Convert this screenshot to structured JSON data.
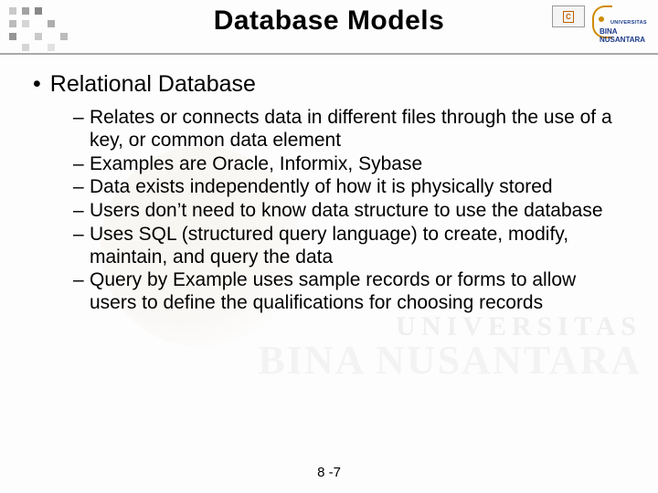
{
  "header": {
    "title": "Database Models",
    "logo_line1": "UNIVERSITAS",
    "logo_line2": "BINA NUSANTARA",
    "badge_text": "C"
  },
  "watermark": {
    "line1": "UNIVERSITAS",
    "line2": "BINA NUSANTARA"
  },
  "content": {
    "topic_bullet": "•",
    "topic": "Relational Database",
    "dash": "–",
    "subs": [
      "Relates or connects data in different files through the use of a key, or common data element",
      "Examples are Oracle, Informix, Sybase",
      "Data exists independently of how it is physically stored",
      "Users don’t need to know data structure to use the database",
      "Uses SQL (structured query language) to create, modify, maintain, and query the data",
      "Query by Example uses sample records or forms to allow users to define the qualifications for choosing records"
    ]
  },
  "footer": {
    "page": "8 -7"
  }
}
